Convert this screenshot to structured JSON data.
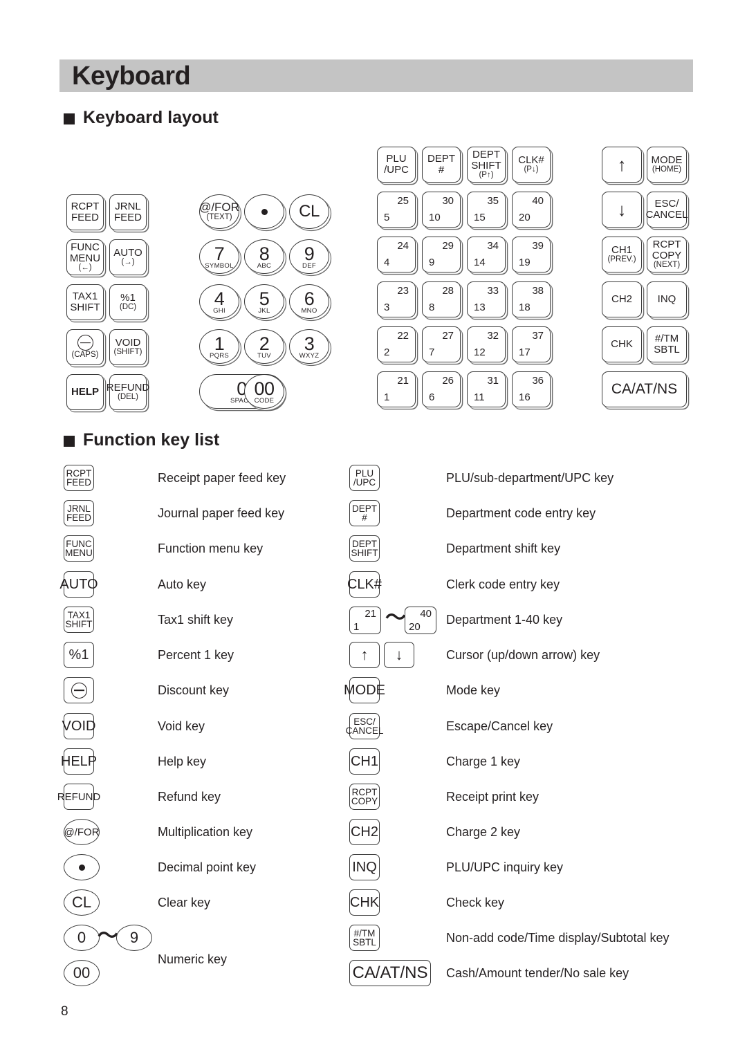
{
  "page": {
    "title": "Keyboard",
    "number": "8"
  },
  "sections": {
    "layout_heading": "Keyboard layout",
    "funclist_heading": "Function key list"
  },
  "keyboard_layout": {
    "function_block": [
      {
        "l1": "RCPT",
        "l2": "FEED",
        "sub": ""
      },
      {
        "l1": "JRNL",
        "l2": "FEED",
        "sub": ""
      },
      {
        "l1": "FUNC",
        "l2": "MENU",
        "sub": "(←)"
      },
      {
        "l1": "AUTO",
        "l2": "",
        "sub": "(→)"
      },
      {
        "l1": "TAX1",
        "l2": "SHIFT",
        "sub": ""
      },
      {
        "l1": "%1",
        "l2": "",
        "sub": "(DC)"
      },
      {
        "l1": "",
        "l2": "",
        "sub": "(CAPS)",
        "icon": "circled-minus-icon"
      },
      {
        "l1": "VOID",
        "l2": "",
        "sub": "(SHIFT)"
      },
      {
        "l1": "HELP",
        "l2": "",
        "sub": "",
        "bold": true
      },
      {
        "l1": "REFUND",
        "l2": "",
        "sub": "(DEL)"
      }
    ],
    "numeric_block": [
      {
        "main": "@/FOR",
        "sub": "(TEXT)",
        "shape": "ellipse",
        "size": "small-label"
      },
      {
        "main": "",
        "sub": "",
        "shape": "ellipse",
        "icon": "dot-icon"
      },
      {
        "main": "CL",
        "sub": "",
        "shape": "ellipse"
      },
      {
        "main": "7",
        "sub": "SYMBOL",
        "shape": "ellipse"
      },
      {
        "main": "8",
        "sub": "ABC",
        "shape": "ellipse"
      },
      {
        "main": "9",
        "sub": "DEF",
        "shape": "ellipse"
      },
      {
        "main": "4",
        "sub": "GHI",
        "shape": "ellipse"
      },
      {
        "main": "5",
        "sub": "JKL",
        "shape": "ellipse"
      },
      {
        "main": "6",
        "sub": "MNO",
        "shape": "ellipse"
      },
      {
        "main": "1",
        "sub": "PQRS",
        "shape": "ellipse"
      },
      {
        "main": "2",
        "sub": "TUV",
        "shape": "ellipse"
      },
      {
        "main": "3",
        "sub": "WXYZ",
        "shape": "ellipse"
      },
      {
        "main": "0",
        "sub": "SPACE",
        "shape": "pill"
      },
      {
        "main": "00",
        "sub": "CODE",
        "shape": "ellipse"
      }
    ],
    "dept_header": [
      {
        "l1": "PLU",
        "l2": "/UPC",
        "sub": ""
      },
      {
        "l1": "DEPT",
        "l2": "#",
        "sub": ""
      },
      {
        "l1": "DEPT",
        "l2": "SHIFT",
        "sub": "(P↑)"
      },
      {
        "l1": "CLK#",
        "l2": "",
        "sub": "(P↓)"
      }
    ],
    "dept_matrix": [
      [
        {
          "hi": "25",
          "lo": "5"
        },
        {
          "hi": "30",
          "lo": "10"
        },
        {
          "hi": "35",
          "lo": "15"
        },
        {
          "hi": "40",
          "lo": "20"
        }
      ],
      [
        {
          "hi": "24",
          "lo": "4"
        },
        {
          "hi": "29",
          "lo": "9"
        },
        {
          "hi": "34",
          "lo": "14"
        },
        {
          "hi": "39",
          "lo": "19"
        }
      ],
      [
        {
          "hi": "23",
          "lo": "3"
        },
        {
          "hi": "28",
          "lo": "8"
        },
        {
          "hi": "33",
          "lo": "13"
        },
        {
          "hi": "38",
          "lo": "18"
        }
      ],
      [
        {
          "hi": "22",
          "lo": "2"
        },
        {
          "hi": "27",
          "lo": "7"
        },
        {
          "hi": "32",
          "lo": "12"
        },
        {
          "hi": "37",
          "lo": "17"
        }
      ],
      [
        {
          "hi": "21",
          "lo": "1"
        },
        {
          "hi": "26",
          "lo": "6"
        },
        {
          "hi": "31",
          "lo": "11"
        },
        {
          "hi": "36",
          "lo": "16"
        }
      ]
    ],
    "right_block": [
      {
        "l1": "↑",
        "l2": "",
        "sub": "",
        "icon": "arrow-up-icon"
      },
      {
        "l1": "MODE",
        "l2": "",
        "sub": "(HOME)"
      },
      {
        "l1": "↓",
        "l2": "",
        "sub": "",
        "icon": "arrow-down-icon"
      },
      {
        "l1": "ESC/",
        "l2": "CANCEL",
        "sub": ""
      },
      {
        "l1": "CH1",
        "l2": "",
        "sub": "(PREV.)"
      },
      {
        "l1": "RCPT",
        "l2": "COPY",
        "sub": "(NEXT)"
      },
      {
        "l1": "CH2",
        "l2": "",
        "sub": ""
      },
      {
        "l1": "INQ",
        "l2": "",
        "sub": ""
      },
      {
        "l1": "CHK",
        "l2": "",
        "sub": ""
      },
      {
        "l1": "#/TM",
        "l2": "SBTL",
        "sub": ""
      }
    ],
    "ca_at_ns": "CA/AT/NS"
  },
  "function_key_list": {
    "left": [
      {
        "key": {
          "a": "RCPT",
          "b": "FEED",
          "shape": "rect"
        },
        "desc": "Receipt paper feed key"
      },
      {
        "key": {
          "a": "JRNL",
          "b": "FEED",
          "shape": "rect"
        },
        "desc": "Journal paper feed key"
      },
      {
        "key": {
          "a": "FUNC",
          "b": "MENU",
          "shape": "rect"
        },
        "desc": "Function menu key"
      },
      {
        "key": {
          "a": "AUTO",
          "b": "",
          "shape": "rect"
        },
        "desc": "Auto key"
      },
      {
        "key": {
          "a": "TAX1",
          "b": "SHIFT",
          "shape": "rect"
        },
        "desc": "Tax1 shift key"
      },
      {
        "key": {
          "a": "%1",
          "b": "",
          "shape": "rect"
        },
        "desc": "Percent 1 key"
      },
      {
        "key": {
          "a": "",
          "b": "",
          "shape": "rect",
          "icon": "circled-minus-icon"
        },
        "desc": "Discount key"
      },
      {
        "key": {
          "a": "VOID",
          "b": "",
          "shape": "rect"
        },
        "desc": "Void key"
      },
      {
        "key": {
          "a": "HELP",
          "b": "",
          "shape": "rect"
        },
        "desc": "Help key"
      },
      {
        "key": {
          "a": "REFUND",
          "b": "",
          "shape": "rect"
        },
        "desc": "Refund key"
      },
      {
        "key": {
          "a": "@/FOR",
          "b": "",
          "shape": "ellipse"
        },
        "desc": "Multiplication key"
      },
      {
        "key": {
          "a": "",
          "b": "",
          "shape": "ellipse",
          "icon": "dot-icon"
        },
        "desc": "Decimal point key"
      },
      {
        "key": {
          "a": "CL",
          "b": "",
          "shape": "ellipse"
        },
        "desc": "Clear key"
      },
      {
        "key": {
          "a": "0",
          "b": "9",
          "shape": "range-ellipse",
          "sep": "～"
        },
        "desc": "Numeric key"
      },
      {
        "key": {
          "a": "00",
          "b": "",
          "shape": "ellipse"
        },
        "desc": ""
      }
    ],
    "right": [
      {
        "key": {
          "a": "PLU",
          "b": "/UPC",
          "shape": "rect"
        },
        "desc": "PLU/sub-department/UPC key"
      },
      {
        "key": {
          "a": "DEPT",
          "b": "#",
          "shape": "rect"
        },
        "desc": "Department code entry key"
      },
      {
        "key": {
          "a": "DEPT",
          "b": "SHIFT",
          "shape": "rect"
        },
        "desc": "Department shift key"
      },
      {
        "key": {
          "a": "CLK#",
          "b": "",
          "shape": "rect"
        },
        "desc": "Clerk code entry key"
      },
      {
        "key": {
          "hi1": "21",
          "lo1": "1",
          "hi2": "40",
          "lo2": "20",
          "sep": "～",
          "shape": "dept-range"
        },
        "desc": "Department 1-40 key"
      },
      {
        "key": {
          "a": "↑",
          "b": "↓",
          "shape": "arrow-pair"
        },
        "desc": "Cursor (up/down arrow) key"
      },
      {
        "key": {
          "a": "MODE",
          "b": "",
          "shape": "rect"
        },
        "desc": "Mode key"
      },
      {
        "key": {
          "a": "ESC/",
          "b": "CANCEL",
          "shape": "rect"
        },
        "desc": "Escape/Cancel key"
      },
      {
        "key": {
          "a": "CH1",
          "b": "",
          "shape": "rect"
        },
        "desc": "Charge 1 key"
      },
      {
        "key": {
          "a": "RCPT",
          "b": "COPY",
          "shape": "rect"
        },
        "desc": "Receipt print key"
      },
      {
        "key": {
          "a": "CH2",
          "b": "",
          "shape": "rect"
        },
        "desc": "Charge 2 key"
      },
      {
        "key": {
          "a": "INQ",
          "b": "",
          "shape": "rect"
        },
        "desc": "PLU/UPC inquiry key"
      },
      {
        "key": {
          "a": "CHK",
          "b": "",
          "shape": "rect"
        },
        "desc": "Check key"
      },
      {
        "key": {
          "a": "#/TM",
          "b": "SBTL",
          "shape": "rect"
        },
        "desc": "Non-add code/Time display/Subtotal key"
      },
      {
        "key": {
          "a": "CA/AT/NS",
          "b": "",
          "shape": "wide"
        },
        "desc": "Cash/Amount tender/No sale key"
      }
    ]
  },
  "colors": {
    "header_bg": "#c4c4c4",
    "ink": "#231f20",
    "key_outline": "#3a3a3a",
    "key_shadow": "#6b6b6b"
  }
}
